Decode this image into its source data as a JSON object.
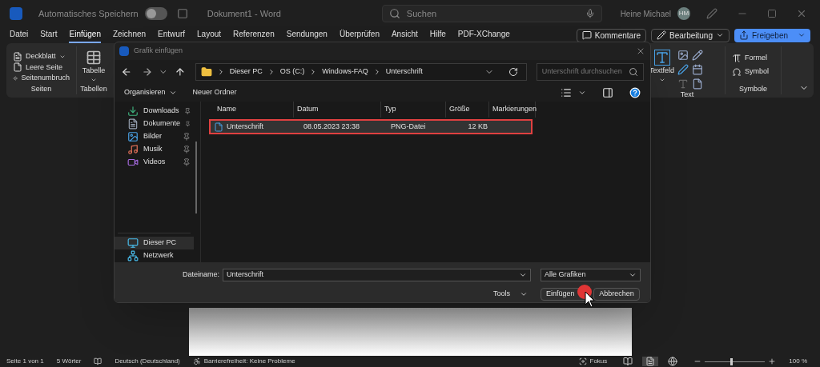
{
  "title_bar": {
    "autosave": {
      "label": "Automatisches Speichern",
      "on": false
    },
    "document_title": "Dokument1 - Word",
    "search": {
      "placeholder": "Suchen"
    },
    "user": {
      "name": "Heine Michael",
      "initials": "HM"
    }
  },
  "menu": [
    {
      "label": "Datei",
      "selected": false
    },
    {
      "label": "Start",
      "selected": false
    },
    {
      "label": "Einfügen",
      "selected": true
    },
    {
      "label": "Zeichnen",
      "selected": false
    },
    {
      "label": "Entwurf",
      "selected": false
    },
    {
      "label": "Layout",
      "selected": false
    },
    {
      "label": "Referenzen",
      "selected": false
    },
    {
      "label": "Sendungen",
      "selected": false
    },
    {
      "label": "Überprüfen",
      "selected": false
    },
    {
      "label": "Ansicht",
      "selected": false
    },
    {
      "label": "Hilfe",
      "selected": false
    },
    {
      "label": "PDF-XChange",
      "selected": false
    }
  ],
  "menu_buttons": {
    "comments": "Kommentare",
    "editing": "Bearbeitung",
    "share": "Freigeben"
  },
  "ribbon": {
    "seiten": {
      "label": "Seiten",
      "items": [
        "Deckblatt",
        "Leere Seite",
        "Seitenumbruch"
      ]
    },
    "tabellen": {
      "label": "Tabellen",
      "item": "Tabelle"
    },
    "text": {
      "label": "Text",
      "item": "Textfeld"
    },
    "symbole": {
      "label": "Symbole",
      "items": [
        "Formel",
        "Symbol"
      ]
    }
  },
  "dialog": {
    "title": "Grafik einfügen",
    "breadcrumb": [
      "Dieser PC",
      "OS (C:)",
      "Windows-FAQ",
      "Unterschrift"
    ],
    "search": {
      "placeholder": "Unterschrift durchsuchen"
    },
    "toolbar": [
      "Organisieren",
      "Neuer Ordner"
    ],
    "nav": [
      {
        "label": "Downloads",
        "pinned": true,
        "selected": false,
        "kind": "downloads"
      },
      {
        "label": "Dokumente",
        "pinned": true,
        "selected": false,
        "kind": "documents"
      },
      {
        "label": "Bilder",
        "pinned": true,
        "selected": false,
        "kind": "pictures"
      },
      {
        "label": "Musik",
        "pinned": true,
        "selected": false,
        "kind": "music"
      },
      {
        "label": "Videos",
        "pinned": true,
        "selected": false,
        "kind": "videos"
      },
      {
        "label": "Dieser PC",
        "pinned": false,
        "selected": true,
        "kind": "pc"
      },
      {
        "label": "Netzwerk",
        "pinned": false,
        "selected": false,
        "kind": "network"
      }
    ],
    "columns": [
      "Name",
      "Datum",
      "Typ",
      "Größe",
      "Markierungen"
    ],
    "rows": [
      {
        "name": "Unterschrift",
        "date": "08.05.2023 23:38",
        "type": "PNG-Datei",
        "size": "12 KB",
        "selected": true
      }
    ],
    "filename_label": "Dateiname:",
    "filename": "Unterschrift",
    "filetype": "Alle Grafiken",
    "tools": "Tools",
    "insert": "Einfügen",
    "cancel": "Abbrechen"
  },
  "status_bar": {
    "page": "Seite 1 von 1",
    "words": "5 Wörter",
    "language": "Deutsch (Deutschland)",
    "accessibility": "Barrierefreiheit: Keine Probleme",
    "focus": "Fokus",
    "views": [
      {
        "kind": "read",
        "selected": false
      },
      {
        "kind": "print",
        "selected": true
      },
      {
        "kind": "web",
        "selected": false
      }
    ],
    "zoom": {
      "level": 0.42,
      "reading": "100 %"
    }
  }
}
